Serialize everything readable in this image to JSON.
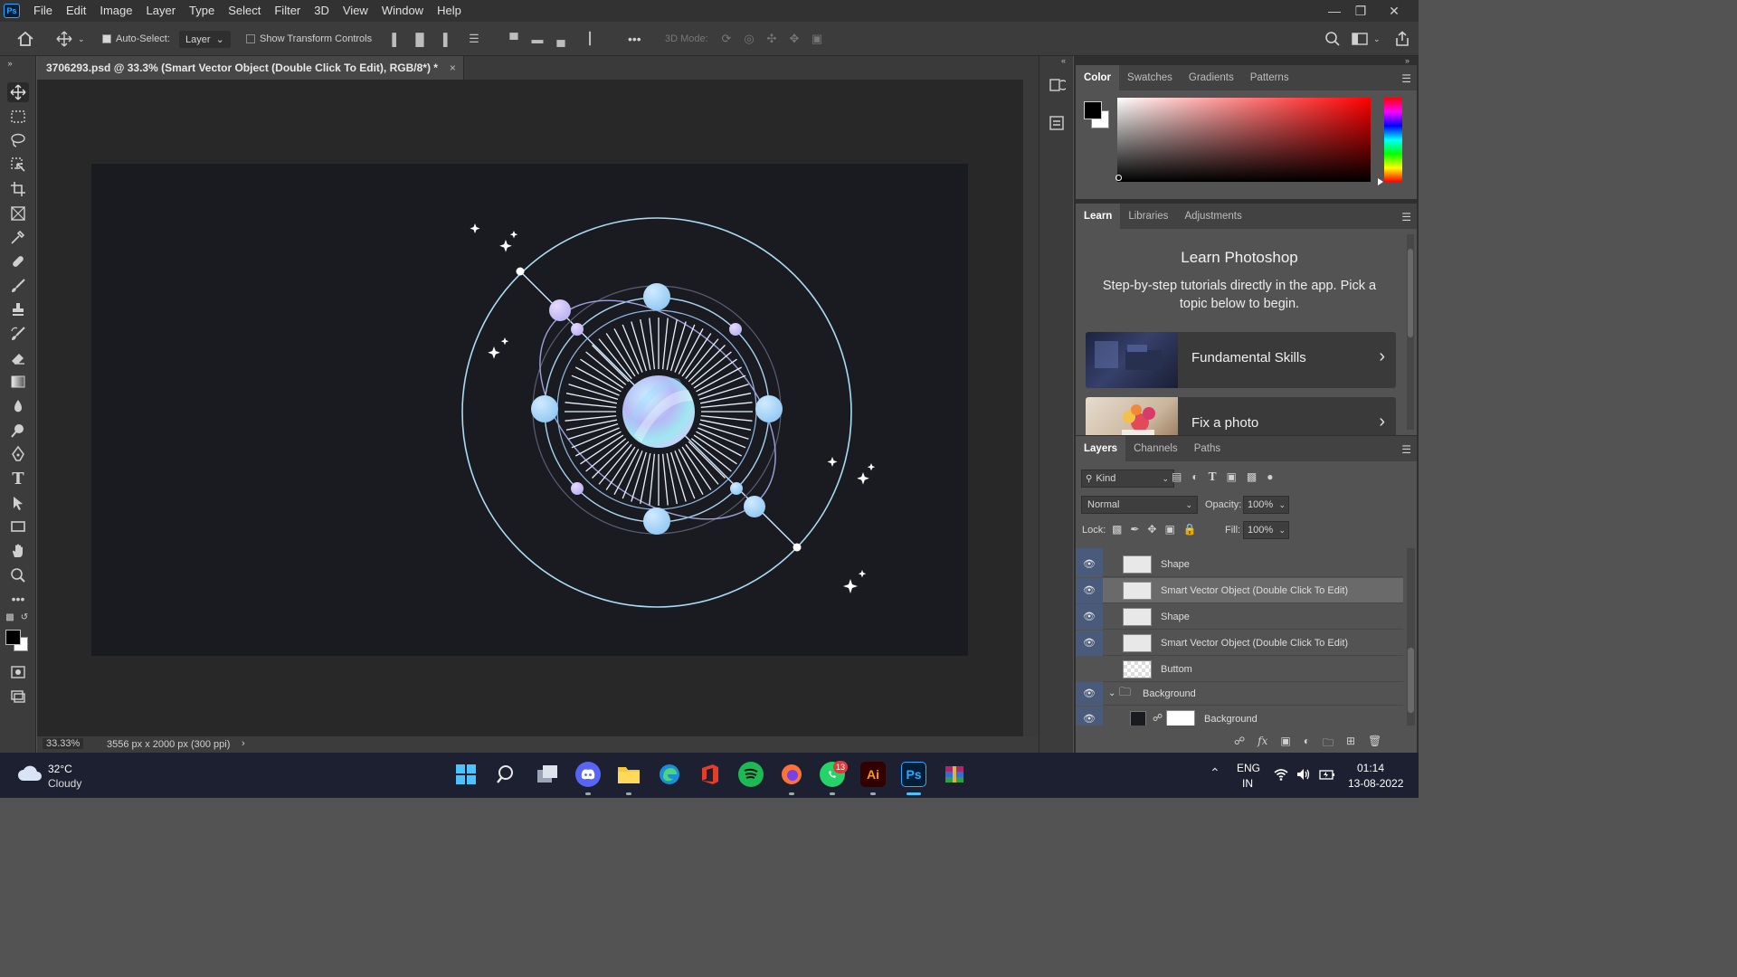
{
  "app": {
    "logo": "Ps"
  },
  "menu": [
    "File",
    "Edit",
    "Image",
    "Layer",
    "Type",
    "Select",
    "Filter",
    "3D",
    "View",
    "Window",
    "Help"
  ],
  "options_bar": {
    "auto_select_label": "Auto-Select:",
    "auto_select_checked": true,
    "auto_select_target": "Layer",
    "show_transform_label": "Show Transform Controls",
    "show_transform_checked": false,
    "more": "•••",
    "mode_3d_label": "3D Mode:"
  },
  "document": {
    "tab_title": "3706293.psd @ 33.3% (Smart Vector Object (Double Click To Edit), RGB/8*) *",
    "zoom": "33.33%",
    "doc_info": "3556 px x 2000 px (300 ppi)",
    "canvas_color": "#1a1b20"
  },
  "color_panel": {
    "tabs": [
      "Color",
      "Swatches",
      "Gradients",
      "Patterns"
    ],
    "active_tab": "Color",
    "hue_base": "#ff0000"
  },
  "learn_panel": {
    "tabs": [
      "Learn",
      "Libraries",
      "Adjustments"
    ],
    "active_tab": "Learn",
    "title": "Learn Photoshop",
    "subtitle": "Step-by-step tutorials directly in the app. Pick a topic below to begin.",
    "cards": [
      {
        "label": "Fundamental Skills"
      },
      {
        "label": "Fix a photo"
      }
    ]
  },
  "layers_panel": {
    "tabs": [
      "Layers",
      "Channels",
      "Paths"
    ],
    "active_tab": "Layers",
    "filter_kind": "Kind",
    "blend_mode": "Normal",
    "opacity_label": "Opacity:",
    "opacity": "100%",
    "lock_label": "Lock:",
    "fill_label": "Fill:",
    "fill": "100%",
    "layers": [
      {
        "name": "Shape",
        "visible": true,
        "selected": false,
        "kind": "shape"
      },
      {
        "name": "Smart Vector Object (Double Click To Edit)",
        "visible": true,
        "selected": true,
        "kind": "smart"
      },
      {
        "name": "Shape",
        "visible": true,
        "selected": false,
        "kind": "shape"
      },
      {
        "name": "Smart Vector Object (Double Click To Edit)",
        "visible": true,
        "selected": false,
        "kind": "smart"
      },
      {
        "name": "Buttom",
        "visible": false,
        "selected": false,
        "kind": "pixel"
      },
      {
        "name": "Background",
        "visible": true,
        "selected": false,
        "kind": "group"
      },
      {
        "name": "Background",
        "visible": true,
        "selected": false,
        "kind": "pixel-masked"
      }
    ]
  },
  "taskbar": {
    "weather_temp": "32°C",
    "weather_desc": "Cloudy",
    "lang_1": "ENG",
    "lang_2": "IN",
    "time": "01:14",
    "date": "13-08-2022",
    "whatsapp_badge": "13",
    "illustrator_label": "Ai",
    "photoshop_label": "Ps"
  }
}
